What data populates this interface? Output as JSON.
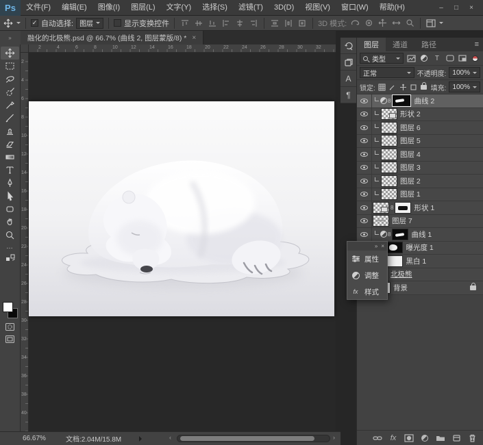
{
  "titlebar": {
    "logo": "Ps",
    "menus": [
      "文件(F)",
      "编辑(E)",
      "图像(I)",
      "图层(L)",
      "文字(Y)",
      "选择(S)",
      "滤镜(T)",
      "3D(D)",
      "视图(V)",
      "窗口(W)",
      "帮助(H)"
    ],
    "window_controls": {
      "minimize": "–",
      "maximize": "□",
      "close": "×"
    }
  },
  "options_bar": {
    "auto_select_label": "自动选择:",
    "auto_select_value": "图层",
    "auto_select_checked": true,
    "show_transform_label": "显示变换控件",
    "show_transform_checked": false,
    "mode_3d_label": "3D 模式:",
    "icon_names": [
      "move-tool-icon",
      "align-top-icon",
      "align-v-center-icon",
      "align-bottom-icon",
      "align-left-icon",
      "align-h-center-icon",
      "align-right-icon",
      "distribute-v-icon",
      "distribute-h-icon",
      "distribute-spacing-icon",
      "3d-orbit-icon",
      "3d-roll-icon",
      "3d-pan-icon",
      "3d-slide-icon",
      "3d-zoom-icon",
      "workspace-switcher-icon"
    ]
  },
  "document_tab": {
    "title": "融化的北极熊.psd @ 66.7% (曲线 2, 图层蒙版/8) *",
    "close": "×",
    "collapse_arrows": "»"
  },
  "toolbar": {
    "selected_tool": "move",
    "tools": [
      "move",
      "rectangular-marquee",
      "lasso",
      "quick-selection",
      "eyedropper",
      "brush",
      "clone-stamp",
      "eraser",
      "gradient",
      "type",
      "pen",
      "path-selection",
      "shape",
      "hand",
      "zoom"
    ],
    "extras": [
      "edit-toolbar-ellipsis",
      "swap-colors",
      "foreground-background-swatch",
      "quick-mask-mode",
      "screen-mode"
    ],
    "ellipsis": "…"
  },
  "rulers": {
    "h": [
      "2",
      "4",
      "6",
      "8",
      "10",
      "12",
      "14",
      "16",
      "18",
      "20",
      "22",
      "24",
      "26",
      "28",
      "30",
      "32"
    ],
    "v": [
      "2",
      "4",
      "6",
      "8",
      "10",
      "12",
      "14",
      "16",
      "18",
      "20",
      "22",
      "24",
      "26",
      "28",
      "30",
      "32",
      "34",
      "36",
      "38",
      "40"
    ]
  },
  "side_strip": {
    "panel_icons": [
      "history-panel-icon",
      "libraries-panel-icon",
      "character-panel-icon",
      "paragraph-panel-icon"
    ],
    "character_glyph": "A",
    "paragraph_glyph": "¶"
  },
  "layers_panel": {
    "tabs": [
      "图层",
      "通道",
      "路径"
    ],
    "panel_menu_icon": "≡",
    "filter_kind": "类型",
    "filter_icons": [
      "pixel-filter-icon",
      "adjustment-filter-icon",
      "type-filter-icon",
      "shape-filter-icon",
      "smart-object-filter-icon",
      "filter-toggle"
    ],
    "blend_mode": "正常",
    "opacity_label": "不透明度:",
    "opacity_value": "100%",
    "lock_label": "锁定:",
    "lock_icons": [
      "lock-transparency-icon",
      "lock-pixels-icon",
      "lock-position-icon",
      "lock-artboard-icon",
      "lock-all-icon"
    ],
    "fill_label": "填充:",
    "fill_value": "100%",
    "layers": [
      {
        "name": "曲线 2",
        "kind": "curves-adjustment",
        "clipped": true,
        "selected": true,
        "visible": true
      },
      {
        "name": "形状 2",
        "kind": "shape",
        "clipped": true,
        "visible": true
      },
      {
        "name": "图层 6",
        "kind": "pixel",
        "clipped": true,
        "visible": true
      },
      {
        "name": "图层 5",
        "kind": "pixel",
        "clipped": true,
        "visible": true
      },
      {
        "name": "图层 4",
        "kind": "pixel",
        "clipped": true,
        "visible": true
      },
      {
        "name": "图层 3",
        "kind": "pixel",
        "clipped": true,
        "visible": true
      },
      {
        "name": "图层 2",
        "kind": "pixel",
        "clipped": true,
        "visible": true
      },
      {
        "name": "图层 1",
        "kind": "pixel",
        "clipped": true,
        "visible": true
      },
      {
        "name": "形状 1",
        "kind": "shape-with-mask",
        "visible": true
      },
      {
        "name": "图层 7",
        "kind": "pixel",
        "visible": true
      },
      {
        "name": "曲线 1",
        "kind": "curves-adjustment",
        "clipped": true,
        "visible": true
      },
      {
        "name": "曝光度 1",
        "kind": "exposure-adjustment",
        "visible": true
      },
      {
        "name": "黑白 1",
        "kind": "black-white-adjustment",
        "visible": true
      },
      {
        "name": "北极熊",
        "kind": "image-layer",
        "visible": true
      },
      {
        "name": "背景",
        "kind": "background",
        "locked": true,
        "visible": true
      }
    ],
    "footer_icons": [
      "link-layers-icon",
      "layer-style-icon",
      "add-mask-icon",
      "new-adjustment-icon",
      "new-group-icon",
      "new-layer-icon",
      "delete-layer-icon"
    ]
  },
  "floating_panel": {
    "collapse": "»",
    "close": "×",
    "items": [
      {
        "icon": "properties-icon",
        "label": "属性"
      },
      {
        "icon": "adjustments-icon",
        "label": "调整"
      },
      {
        "icon": "styles-icon",
        "label": "样式"
      }
    ]
  },
  "status_bar": {
    "zoom": "66.67%",
    "doc_info": "文档:2.04M/15.8M",
    "scroll_left": "‹",
    "scroll_right": "›"
  },
  "colors": {
    "panel": "#424242",
    "selected_row": "#606060",
    "canvas_bg": "#282828",
    "logo_blue": "#6fb6e8"
  }
}
